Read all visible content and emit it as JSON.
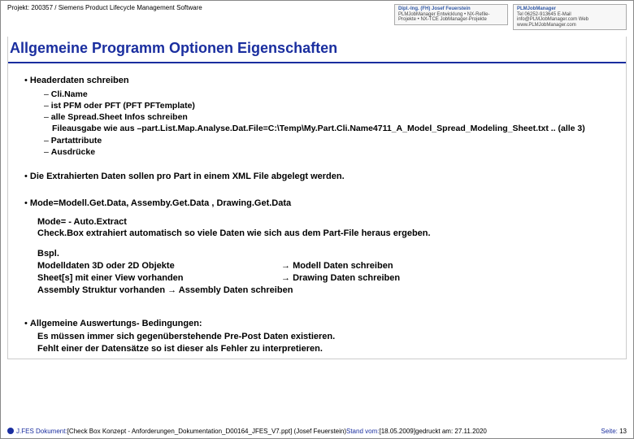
{
  "header": {
    "project_line": "Projekt: 200357 / Siemens Product Lifecycle Management Software",
    "logo1_t1": "Dipl.-Ing. (FH) Josef Feuerstein",
    "logo1_t2": "PLMJobManager Entwicklung • NX-Refile-Projekte • NX-TCE JobManager-Projekte",
    "logo2_t1": "PLMJobManager",
    "logo2_t2": "Tel 06252-913645  E-Mail info@PLMJobManager.com  Web www.PLMJobManager.com"
  },
  "title": "Allgemeine Programm Optionen Eigenschaften",
  "b1": "Headerdaten schreiben",
  "d1": "Cli.Name",
  "d2": "ist PFM oder PFT  (PFT PFTemplate)",
  "d3": "alle Spread.Sheet Infos schreiben",
  "d3s": "Fileausgabe wie aus –part.List.Map.Analyse.Dat.File=C:\\Temp\\My.Part.Cli.Name4711_A_Model_Spread_Modeling_Sheet.txt .. (alle 3)",
  "d4": "Partattribute",
  "d5": "Ausdrücke",
  "b2": "Die Extrahierten Daten sollen pro Part in einem XML File abgelegt werden.",
  "b3": "Mode=Modell.Get.Data, Assemby.Get.Data , Drawing.Get.Data",
  "p1": "Mode= - Auto.Extract",
  "p2": "Check.Box extrahiert automatisch so viele Daten wie sich aus dem Part-File heraus ergeben.",
  "p3": "Bspl.",
  "colL1": "Modelldaten 3D oder 2D Objekte",
  "colR1": "Modell Daten schreiben",
  "colL2": "Sheet[s] mit einer View vorhanden",
  "colR2": "Drawing Daten schreiben",
  "asm": "Assembly Struktur vorhanden  → Assembly Daten schreiben",
  "b4a": "Allgemeine Auswertungs- Bedingungen:",
  "b4b": "Es müssen immer sich gegenüberstehende Pre-Post Daten existieren.",
  "b4c": "Fehlt einer der Datensätze so ist dieser als Fehler zu interpretieren.",
  "footer": {
    "pre": "J.FES Dokument:",
    "doc": " [Check Box Konzept - Anforderungen_Dokumentation_D00164_JFES_V7.ppt]  (Josef Feuerstein) ",
    "stand_lbl": "Stand vom:",
    "stand_val": " [18.05.2009] ",
    "printed": "gedruckt am: 27.11.2020",
    "seite_lbl": "Seite:",
    "seite_val": " 13"
  }
}
